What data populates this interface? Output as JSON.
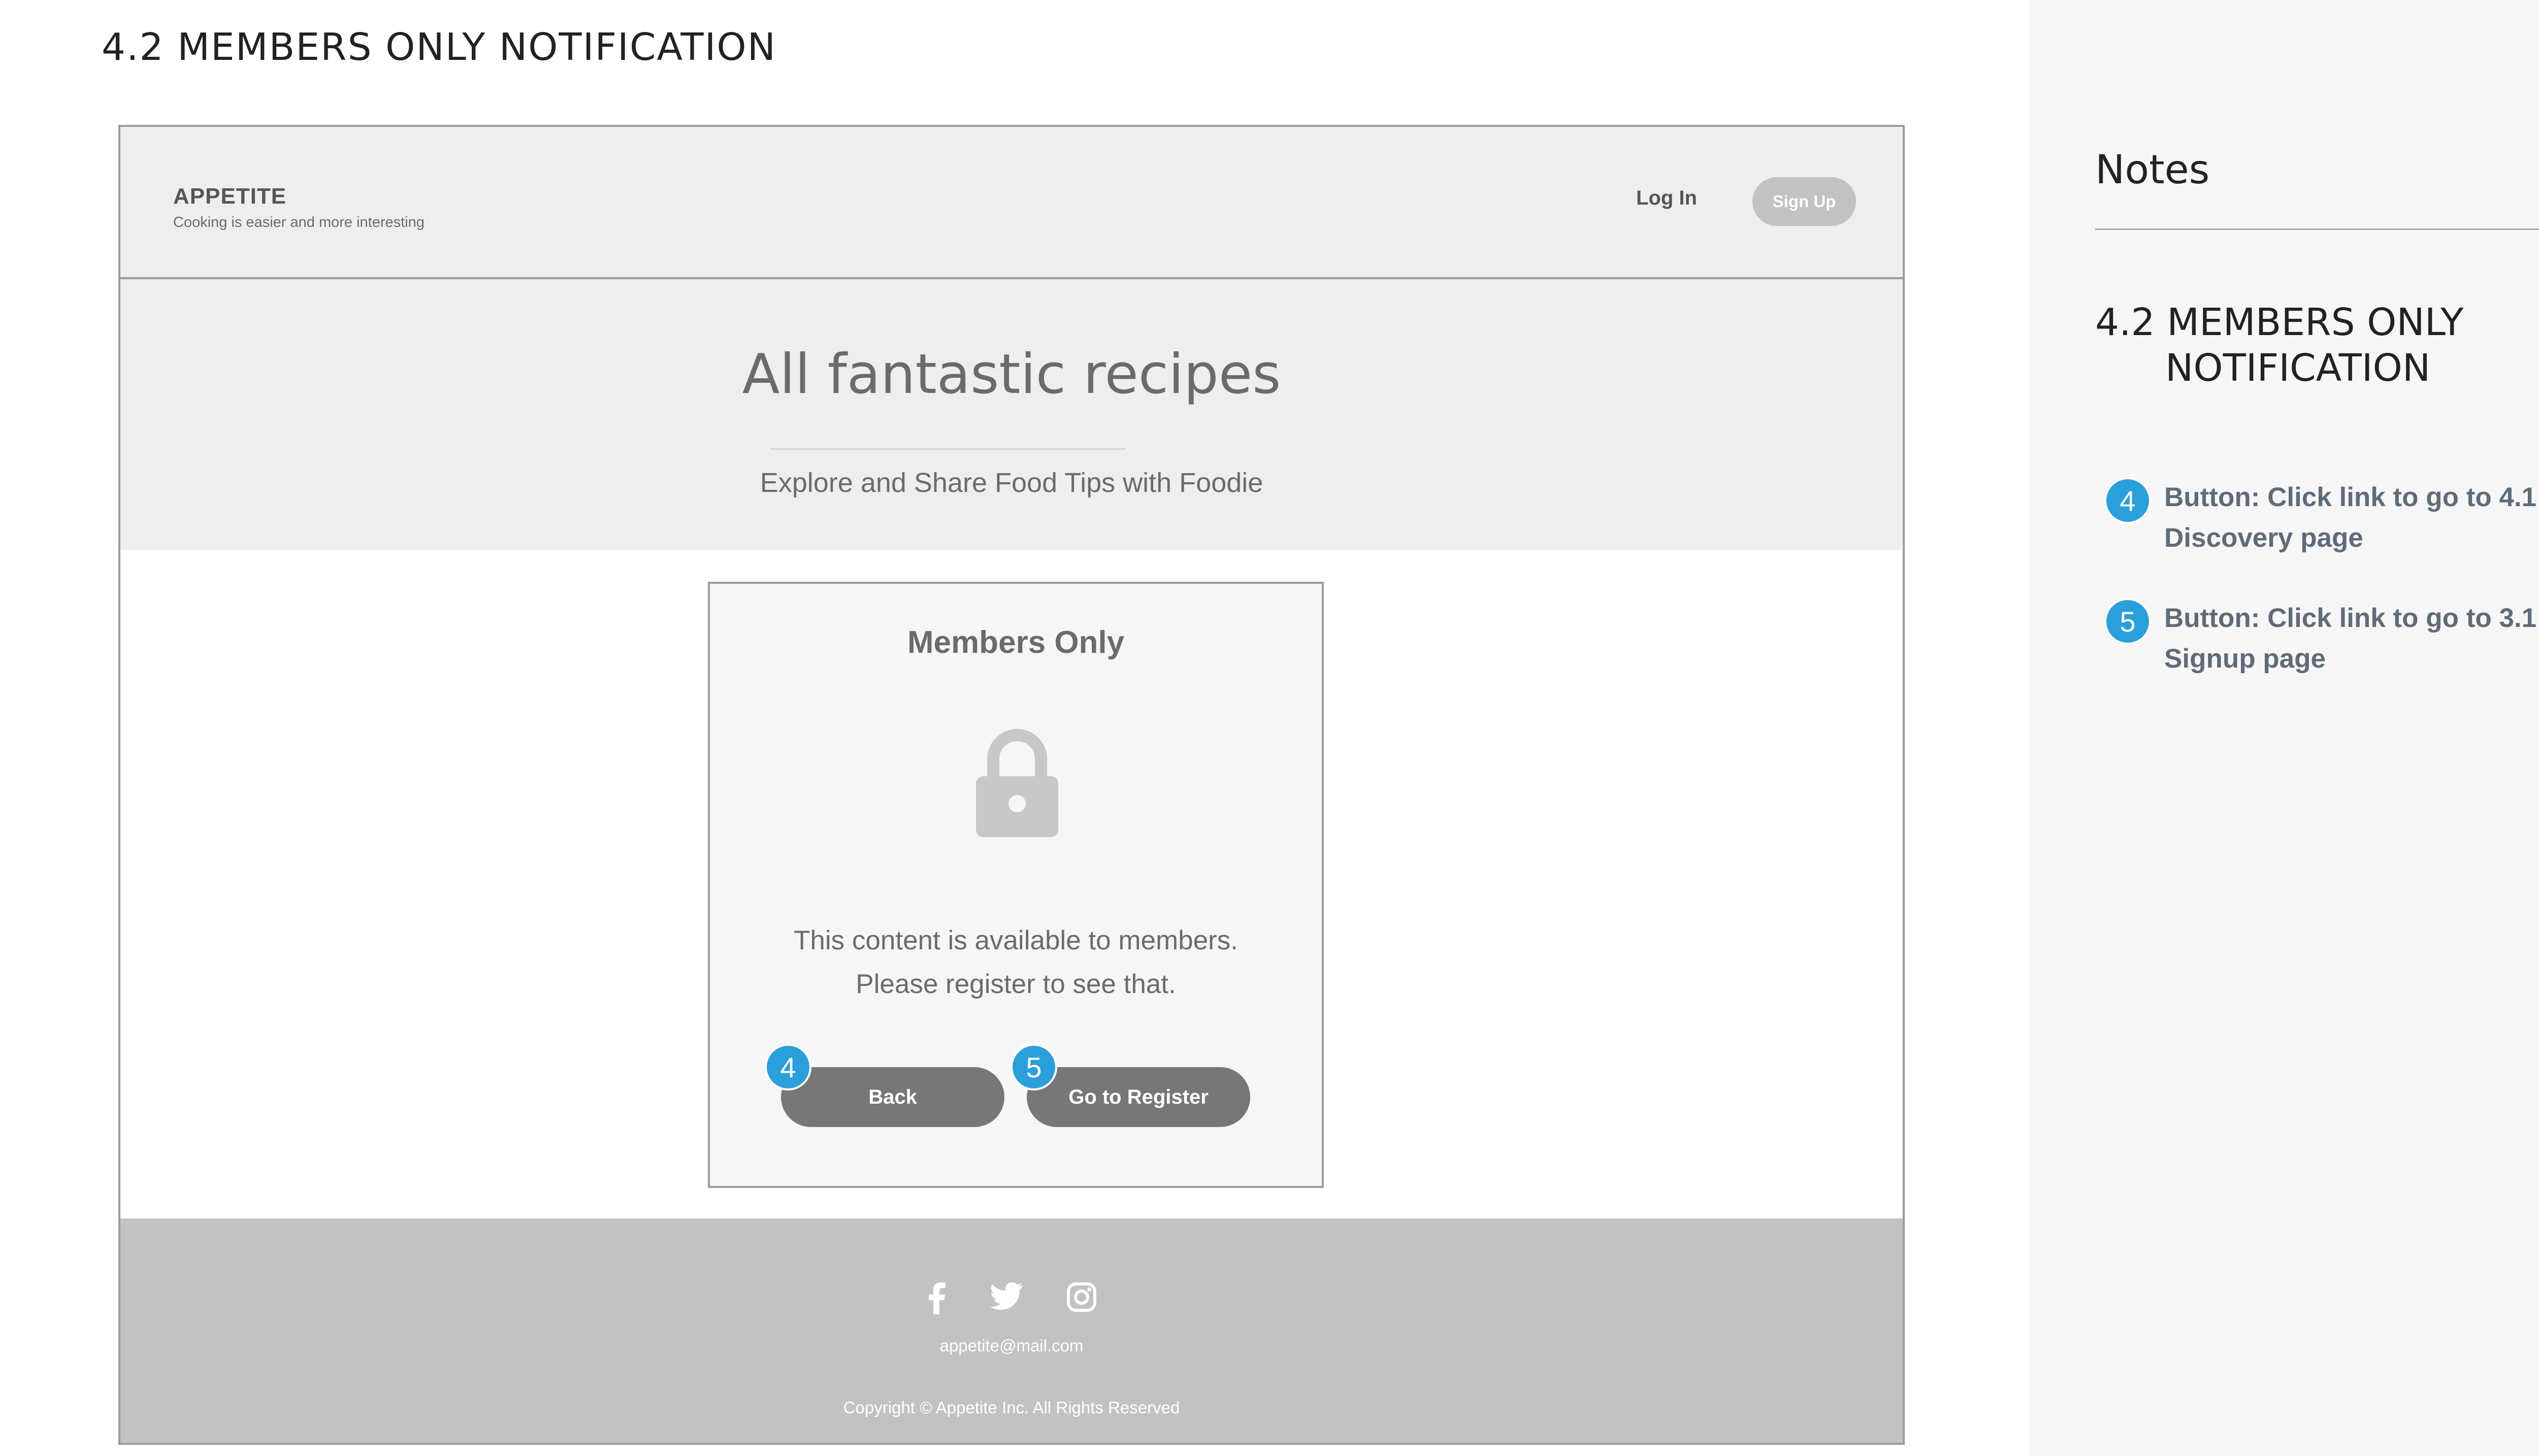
{
  "page": {
    "title": "4.2  MEMBERS ONLY NOTIFICATION"
  },
  "wireframe": {
    "brand": {
      "name": "APPETITE",
      "tagline": "Cooking is easier and more interesting"
    },
    "nav": {
      "login_label": "Log In",
      "signup_label": "Sign Up"
    },
    "hero": {
      "title": "All fantastic recipes",
      "subtitle": "Explore and Share Food Tips with Foodie"
    },
    "modal": {
      "title": "Members Only",
      "icon": "lock-icon",
      "message_line1": "This content is  available to members.",
      "message_line2": "Please register to see that.",
      "back_label": "Back",
      "register_label": "Go to Register",
      "back_marker": "4",
      "register_marker": "5"
    },
    "footer": {
      "social_icons": [
        "facebook-icon",
        "twitter-icon",
        "instagram-icon"
      ],
      "email": "appetite@mail.com",
      "copyright": "Copyright © Appetite Inc. All Rights Reserved"
    }
  },
  "notes": {
    "heading": "Notes",
    "section_line1": "4.2 MEMBERS ONLY",
    "section_line2": "NOTIFICATION",
    "items": [
      {
        "marker": "4",
        "text": "Button: Click link to go to 4.1 Discovery page"
      },
      {
        "marker": "5",
        "text": "Button: Click link to go to 3.1 Signup page"
      }
    ]
  },
  "colors": {
    "marker": "#2b9fda",
    "button": "#777777",
    "nav_bg": "#eeeeee",
    "footer_bg": "#c2c2c2",
    "notes_text": "#5f6b78"
  }
}
